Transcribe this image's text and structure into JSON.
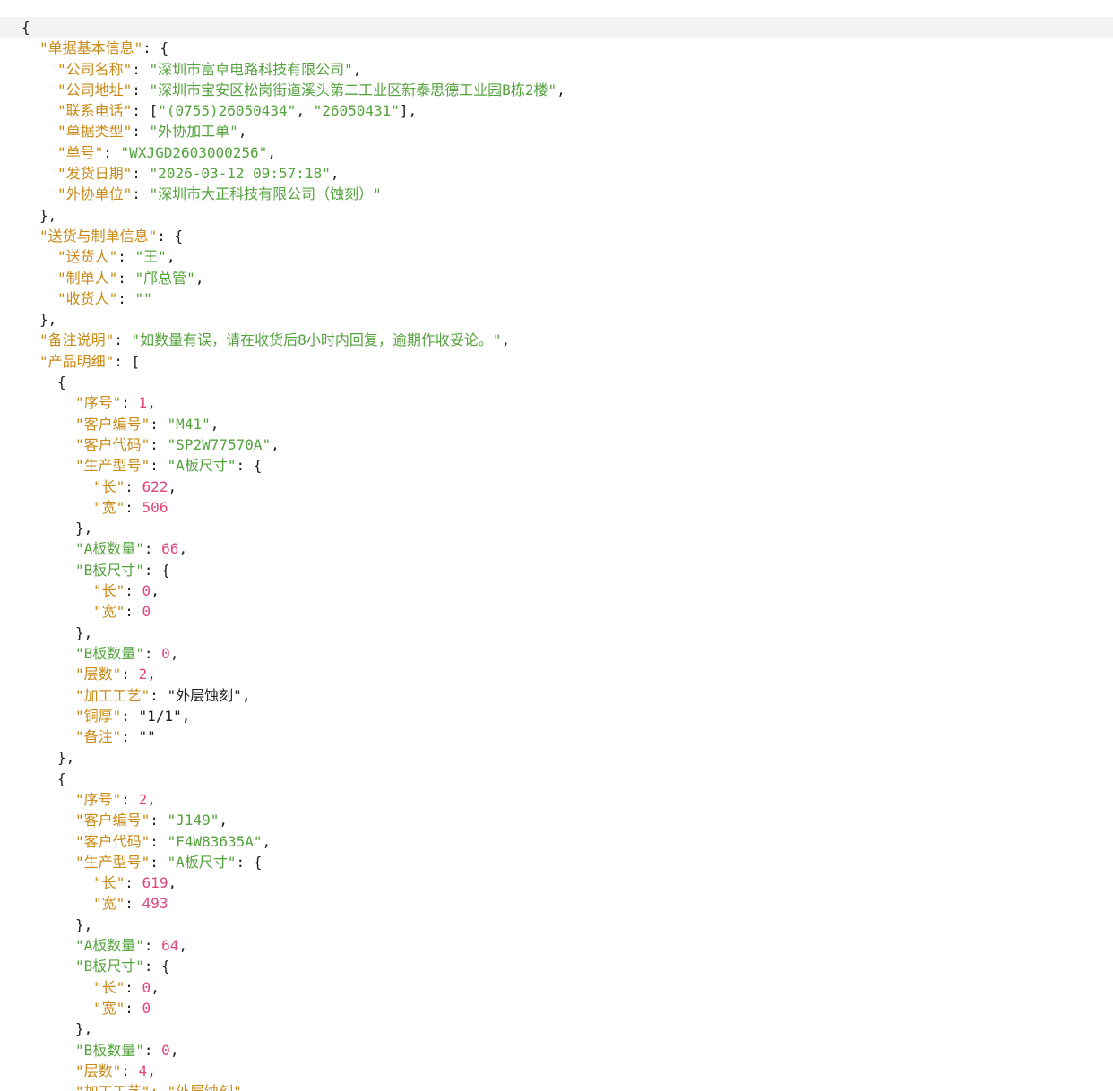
{
  "doc": {
    "l0": "{",
    "basic_key": "\"单据基本信息\"",
    "company_name_key": "\"公司名称\"",
    "company_name_val": "\"深圳市富卓电路科技有限公司\"",
    "company_addr_key": "\"公司地址\"",
    "company_addr_val": "\"深圳市宝安区松岗街道溪头第二工业区新泰思德工业园B栋2楼\"",
    "phone_key": "\"联系电话\"",
    "phone_val1": "\"(0755)26050434\"",
    "phone_val2": "\"26050431\"",
    "doc_type_key": "\"单据类型\"",
    "doc_type_val": "\"外协加工单\"",
    "doc_no_key": "\"单号\"",
    "doc_no_val": "\"WXJGD2603000256\"",
    "ship_date_key": "\"发货日期\"",
    "ship_date_val": "\"2026-03-12 09:57:18\"",
    "vendor_key": "\"外协单位\"",
    "vendor_val": "\"深圳市大正科技有限公司（蚀刻）\"",
    "delivery_key": "\"送货与制单信息\"",
    "deliverer_key": "\"送货人\"",
    "deliverer_val": "\"王\"",
    "maker_key": "\"制单人\"",
    "maker_val": "\"邝总管\"",
    "receiver_key": "\"收货人\"",
    "receiver_val": "\"\"",
    "remark_key": "\"备注说明\"",
    "remark_val": "\"如数量有误，请在收货后8小时内回复，逾期作收妥论。\"",
    "products_key": "\"产品明细\"",
    "seq_key": "\"序号\"",
    "cust_no_key": "\"客户编号\"",
    "cust_code_key": "\"客户代码\"",
    "model_key": "\"生产型号\"",
    "a_size_key": "\"A板尺寸\"",
    "len_key": "\"长\"",
    "wid_key": "\"宽\"",
    "a_qty_key": "\"A板数量\"",
    "b_size_key": "\"B板尺寸\"",
    "b_qty_key": "\"B板数量\"",
    "layers_key": "\"层数\"",
    "process_key": "\"加工工艺\"",
    "copper_key": "\"铜厚\"",
    "note_key": "\"备注\""
  },
  "products": [
    {
      "seq": "1",
      "cust_no": "\"M41\"",
      "cust_code": "\"SP2W77570A\"",
      "a_len": "622",
      "a_wid": "506",
      "a_qty": "66",
      "b_len": "0",
      "b_wid": "0",
      "b_qty": "0",
      "layers": "2",
      "process": "\"外层蚀刻\"",
      "copper": "\"1/1\"",
      "note": "\"\""
    },
    {
      "seq": "2",
      "cust_no": "\"J149\"",
      "cust_code": "\"F4W83635A\"",
      "a_len": "619",
      "a_wid": "493",
      "a_qty": "64",
      "b_len": "0",
      "b_wid": "0",
      "b_qty": "0",
      "layers": "4",
      "process_partial": "\"加工工艺\": \"外层蚀刻\","
    }
  ],
  "colors": {
    "key": "#c98a16",
    "string": "#54a33d",
    "number": "#e0457b",
    "punct": "#1f1f1f",
    "current_line_bg": "#f3f3f3"
  }
}
